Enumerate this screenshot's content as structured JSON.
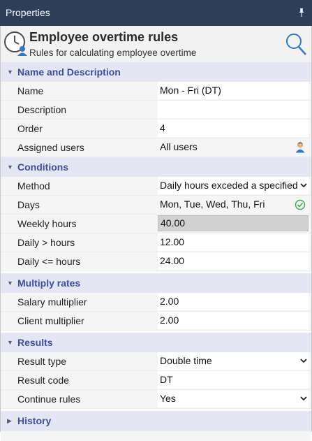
{
  "panel": {
    "title": "Properties"
  },
  "header": {
    "title": "Employee overtime rules",
    "subtitle": "Rules for calculating employee overtime"
  },
  "sections": {
    "name_desc": {
      "label": "Name and Description",
      "name_label": "Name",
      "name_value": "Mon - Fri (DT)",
      "description_label": "Description",
      "description_value": "",
      "order_label": "Order",
      "order_value": "4",
      "assigned_label": "Assigned users",
      "assigned_value": "All users"
    },
    "conditions": {
      "label": "Conditions",
      "method_label": "Method",
      "method_value": "Daily hours exceded a specified",
      "days_label": "Days",
      "days_value": "Mon, Tue, Wed, Thu, Fri",
      "weekly_label": "Weekly hours",
      "weekly_value": "40.00",
      "daily_gt_label": "Daily > hours",
      "daily_gt_value": "12.00",
      "daily_le_label": "Daily <= hours",
      "daily_le_value": "24.00"
    },
    "multiply": {
      "label": "Multiply rates",
      "salary_label": "Salary multiplier",
      "salary_value": "2.00",
      "client_label": "Client multiplier",
      "client_value": "2.00"
    },
    "results": {
      "label": "Results",
      "type_label": "Result type",
      "type_value": "Double time",
      "code_label": "Result code",
      "code_value": "DT",
      "continue_label": "Continue rules",
      "continue_value": "Yes"
    },
    "history": {
      "label": "History"
    }
  },
  "icons": {
    "pin": "pin-icon",
    "clock": "clock-user-icon",
    "search": "search-icon",
    "user": "user-icon",
    "check": "check-circle-icon",
    "expanded": "triangle-down",
    "collapsed": "triangle-right"
  },
  "colors": {
    "titlebar": "#2c3e58",
    "section_bg": "#e4e6f4",
    "section_text": "#3e4e9a",
    "accent_blue": "#2f7bc4",
    "check_green": "#3daa52"
  }
}
